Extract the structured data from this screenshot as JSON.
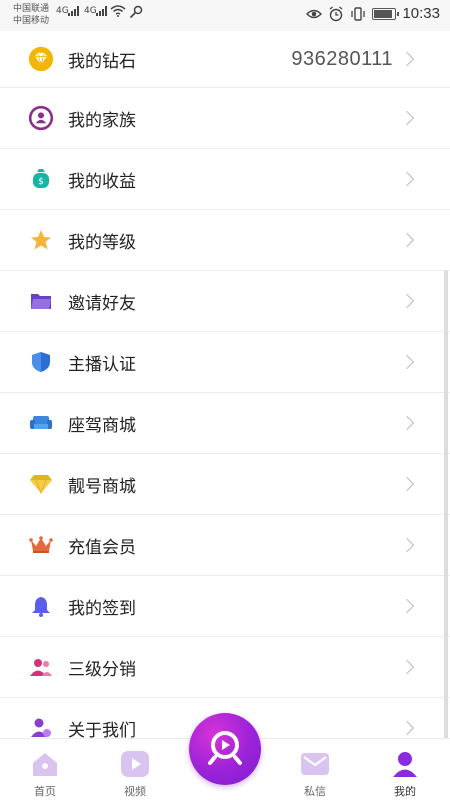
{
  "status_bar": {
    "carrier_line1": "中国联通",
    "carrier_line2": "中国移动",
    "network1": "4G",
    "network2": "4G",
    "time": "10:33"
  },
  "menu": [
    {
      "label": "我的钻石",
      "value": "936280111",
      "icon": "diamond-icon",
      "color": "#f2b705"
    },
    {
      "label": "我的家族",
      "icon": "family-icon",
      "color": "#8a2f8a"
    },
    {
      "label": "我的收益",
      "icon": "money-bag-icon",
      "color": "#19b5a4"
    },
    {
      "label": "我的等级",
      "icon": "star-icon",
      "color": "#f4b63a"
    },
    {
      "label": "邀请好友",
      "icon": "folder-icon",
      "color": "#6a3fc9"
    },
    {
      "label": "主播认证",
      "icon": "shield-icon",
      "color": "#2b6fd6"
    },
    {
      "label": "座驾商城",
      "icon": "sofa-icon",
      "color": "#3d86e0"
    },
    {
      "label": "靓号商城",
      "icon": "gem-icon",
      "color": "#e8b21e"
    },
    {
      "label": "充值会员",
      "icon": "crown-icon",
      "color": "#e46a3b"
    },
    {
      "label": "我的签到",
      "icon": "bell-icon",
      "color": "#5a5de8"
    },
    {
      "label": "三级分销",
      "icon": "users-icon",
      "color": "#d8317b"
    },
    {
      "label": "关于我们",
      "icon": "user-info-icon",
      "color": "#8a3fd0"
    }
  ],
  "tabs": [
    {
      "label": "首页",
      "icon": "home-icon"
    },
    {
      "label": "视频",
      "icon": "video-icon"
    },
    {
      "label": "私信",
      "icon": "mail-icon"
    },
    {
      "label": "我的",
      "icon": "profile-icon"
    }
  ],
  "colors": {
    "accent": "#9a22d8",
    "tab_inactive": "#d9c3f0",
    "tab_active": "#8a2be2"
  }
}
